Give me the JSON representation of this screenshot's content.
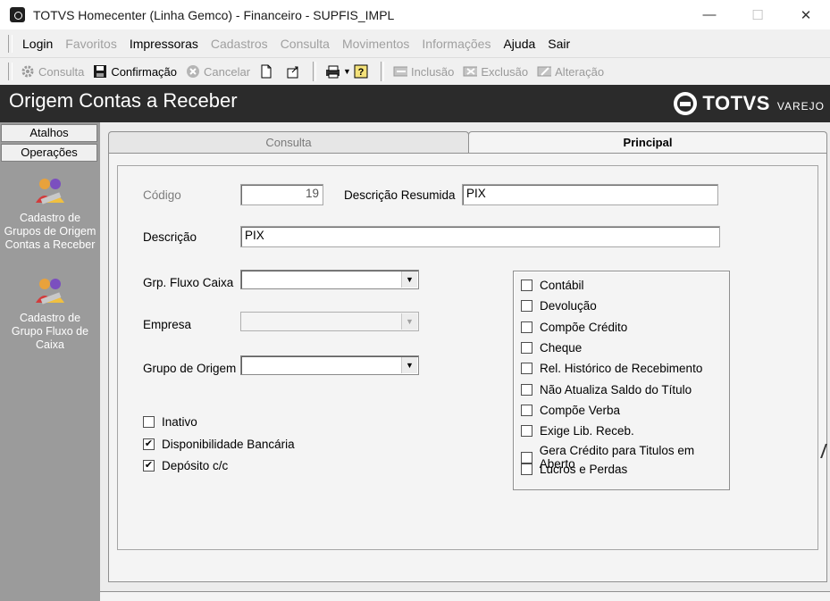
{
  "window": {
    "title": "TOTVS Homecenter (Linha Gemco) - Financeiro - SUPFIS_IMPL"
  },
  "menu": [
    {
      "label": "Login",
      "enabled": true
    },
    {
      "label": "Favoritos",
      "enabled": false
    },
    {
      "label": "Impressoras",
      "enabled": true
    },
    {
      "label": "Cadastros",
      "enabled": false
    },
    {
      "label": "Consulta",
      "enabled": false
    },
    {
      "label": "Movimentos",
      "enabled": false
    },
    {
      "label": "Informações",
      "enabled": false
    },
    {
      "label": "Ajuda",
      "enabled": true
    },
    {
      "label": "Sair",
      "enabled": true
    }
  ],
  "toolbar": {
    "consulta": "Consulta",
    "confirmacao": "Confirmação",
    "cancelar": "Cancelar",
    "inclusao": "Inclusão",
    "exclusao": "Exclusão",
    "alteracao": "Alteração"
  },
  "header": {
    "title": "Origem Contas a Receber",
    "logo": "TOTVS",
    "logo_sub": "VAREJO"
  },
  "sidebar": {
    "tabs": [
      "Atalhos",
      "Operações"
    ],
    "items": [
      "Cadastro de Grupos de Origem Contas a Receber",
      "Cadastro de Grupo Fluxo de Caixa"
    ]
  },
  "tabs": {
    "consulta": "Consulta",
    "principal": "Principal"
  },
  "form": {
    "codigo_label": "Código",
    "codigo_value": "19",
    "desc_resumida_label": "Descrição Resumida",
    "desc_resumida_value": "PIX",
    "descricao_label": "Descrição",
    "descricao_value": "PIX",
    "grp_fluxo_label": "Grp. Fluxo Caixa",
    "empresa_label": "Empresa",
    "grupo_origem_label": "Grupo de Origem"
  },
  "left_checks": [
    {
      "label": "Inativo",
      "checked": false
    },
    {
      "label": "Disponibilidade Bancária",
      "checked": true
    },
    {
      "label": "Depósito c/c",
      "checked": true
    }
  ],
  "right_checks": [
    {
      "label": "Contábil",
      "checked": false
    },
    {
      "label": "Devolução",
      "checked": false
    },
    {
      "label": "Compõe Crédito",
      "checked": false
    },
    {
      "label": "Cheque",
      "checked": false
    },
    {
      "label": "Rel. Histórico de Recebimento",
      "checked": false
    },
    {
      "label": "Não Atualiza Saldo do Título",
      "checked": false
    },
    {
      "label": "Compõe Verba",
      "checked": false
    },
    {
      "label": "Exige Lib. Receb.",
      "checked": false
    },
    {
      "label": "Gera Crédito para Titulos em Aberto",
      "checked": false
    },
    {
      "label": "Lucros e Perdas",
      "checked": false
    }
  ],
  "colors": {
    "header_bg": "#2b2b2b",
    "sidebar_bg": "#9b9b9b"
  }
}
